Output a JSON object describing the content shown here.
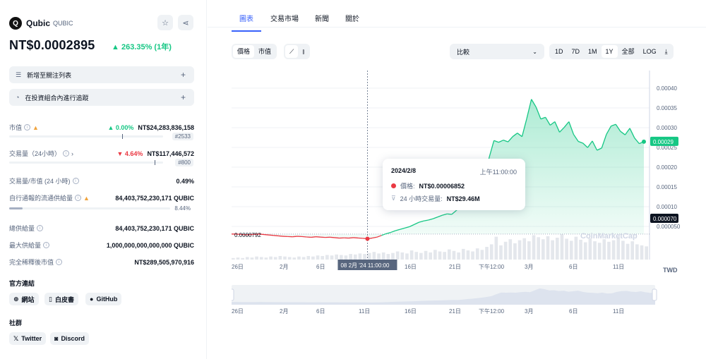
{
  "coin": {
    "name": "Qubic",
    "symbol": "QUBIC",
    "logo_glyph": "Q",
    "price": "NT$0.0002895",
    "change": "263.35% (1年)"
  },
  "actions": {
    "watchlist": "新增至關注列表",
    "portfolio": "在投資組合內進行追蹤"
  },
  "stats": {
    "market_cap": {
      "label": "市值",
      "change": "0.00%",
      "value": "NT$24,283,836,158",
      "rank": "#2533"
    },
    "volume": {
      "label": "交易量（24小時）",
      "change": "4.64%",
      "value": "NT$117,446,572",
      "rank": "#800"
    },
    "vol_mcap": {
      "label": "交易量/市值 (24 小時)",
      "value": "0.49%"
    },
    "circ_supply": {
      "label": "自行通報的流通供給量",
      "value": "84,403,752,230,171 QUBIC",
      "percent": "8.44%",
      "fill": 0.0844
    },
    "total_supply": {
      "label": "總供給量",
      "value": "84,403,752,230,171 QUBIC"
    },
    "max_supply": {
      "label": "最大供給量",
      "value": "1,000,000,000,000,000 QUBIC"
    },
    "fdv": {
      "label": "完全稀釋後市值",
      "value": "NT$289,505,970,916"
    }
  },
  "links": {
    "official_title": "官方連結",
    "website": "網站",
    "whitepaper": "白皮書",
    "github": "GitHub",
    "social_title": "社群",
    "twitter": "Twitter",
    "discord": "Discord"
  },
  "tabs": [
    "圖表",
    "交易市場",
    "新聞",
    "關於"
  ],
  "controls": {
    "price_tab": "價格",
    "mcap_tab": "市值",
    "compare": "比較",
    "ranges": [
      "1D",
      "7D",
      "1M",
      "1Y",
      "全部"
    ],
    "selected_range": "1Y",
    "log": "LOG",
    "download_icon": "download-icon"
  },
  "tooltip": {
    "date": "2024/2/8",
    "time": "上午11:00:00",
    "price_label": "價格:",
    "price": "NT$0.00006852",
    "volume_label": "24 小時交易量:",
    "volume": "NT$29.46M"
  },
  "currency": "TWD",
  "watermark": "CoinMarketCap",
  "chart_data": {
    "type": "area",
    "y_ticks": [
      "0.00040",
      "0.00035",
      "0.00030",
      "0.00025",
      "0.00020",
      "0.00015",
      "0.00010",
      "0.000050"
    ],
    "ylim": [
      5e-05,
      0.0004
    ],
    "x_ticks": [
      "26日",
      "2月",
      "6日",
      "11日",
      "16日",
      "21日",
      "下午12:00",
      "3月",
      "6日",
      "11日"
    ],
    "hover_x_label": "08 2月 '24   11:00:00",
    "start_price_label": "0.0000792",
    "start_price": 7.92e-05,
    "current_price_label": "0.00029",
    "current_price": 0.00029,
    "min_price_label": "0.000070",
    "series": [
      {
        "values": [
          7.92e-05,
          7.9e-05,
          7.85e-05,
          7.75e-05,
          7.8e-05,
          7.85e-05,
          7.9e-05,
          7.8e-05,
          7.7e-05,
          7.6e-05,
          7.5e-05,
          7.4e-05,
          7.35e-05,
          7.3e-05,
          7.4e-05,
          7.35e-05,
          7.25e-05,
          7.18e-05,
          7.3e-05,
          7.22e-05,
          7.15e-05,
          7.2e-05,
          7.1e-05,
          7e-05,
          7.05e-05,
          7e-05,
          7.1e-05,
          7.02e-05,
          6.95e-05,
          6.85e-05,
          7e-05,
          7.2e-05,
          7.6e-05,
          8e-05,
          8.3e-05,
          8.7e-05,
          9e-05,
          9.3e-05,
          9.6e-05,
          0.000101,
          0.000106,
          0.000109,
          0.000111,
          0.000114,
          0.000118,
          0.000122,
          0.000125,
          0.000124,
          0.000133,
          0.000146,
          0.000154,
          0.000165,
          0.000178,
          0.000194,
          0.000212,
          0.000254,
          0.000292,
          0.000288,
          0.000293,
          0.000289,
          0.000301,
          0.000309,
          0.000301,
          0.000342,
          0.000386,
          0.000368,
          0.000341,
          0.000345,
          0.000327,
          0.000335,
          0.000311,
          0.000322,
          0.000335,
          0.000306,
          0.00029,
          0.000286,
          0.000276,
          0.000291,
          0.00027,
          0.000275,
          0.000306,
          0.000325,
          0.000329,
          0.000313,
          0.000305,
          0.00032,
          0.000298,
          0.000285,
          0.0002895
        ]
      }
    ],
    "volume": [
      3,
      4,
      3,
      5,
      4,
      6,
      5,
      4,
      6,
      5,
      7,
      6,
      5,
      4,
      6,
      5,
      7,
      6,
      8,
      7,
      9,
      8,
      10,
      9,
      8,
      11,
      10,
      12,
      11,
      13,
      15,
      12,
      14,
      11,
      13,
      16,
      14,
      12,
      18,
      15,
      13,
      17,
      14,
      19,
      16,
      15,
      20,
      17,
      14,
      21,
      18,
      16,
      22,
      19,
      25,
      30,
      45,
      28,
      35,
      40,
      32,
      38,
      42,
      36,
      48,
      44,
      40,
      46,
      38,
      43,
      50,
      41,
      37,
      45,
      39,
      34,
      42,
      36,
      33,
      40,
      35,
      38,
      44,
      37,
      31,
      36,
      30,
      28,
      26
    ]
  }
}
